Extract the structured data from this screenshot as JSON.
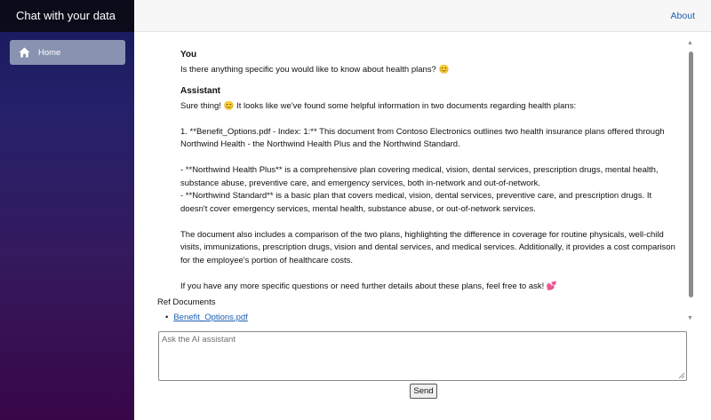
{
  "sidebar": {
    "title": "Chat with your data",
    "items": [
      {
        "label": "Home",
        "icon": "home-icon",
        "active": true
      }
    ]
  },
  "topbar": {
    "about_label": "About"
  },
  "chat": {
    "messages": [
      {
        "role": "You",
        "text": "Is there anything specific you would like to know about health plans? 😊"
      },
      {
        "role": "Assistant",
        "text": "Sure thing! 😊 It looks like we've found some helpful information in two documents regarding health plans:\n\n1. **Benefit_Options.pdf - Index: 1:** This document from Contoso Electronics outlines two health insurance plans offered through Northwind Health - the Northwind Health Plus and the Northwind Standard.\n\n- **Northwind Health Plus** is a comprehensive plan covering medical, vision, dental services, prescription drugs, mental health, substance abuse, preventive care, and emergency services, both in-network and out-of-network.\n- **Northwind Standard** is a basic plan that covers medical, vision, dental services, preventive care, and prescription drugs. It doesn't cover emergency services, mental health, substance abuse, or out-of-network services.\n\nThe document also includes a comparison of the two plans, highlighting the difference in coverage for routine physicals, well-child visits, immunizations, prescription drugs, vision and dental services, and medical services. Additionally, it provides a cost comparison for the employee's portion of healthcare costs.\n\nIf you have any more specific questions or need further details about these plans, feel free to ask! 💕"
      }
    ]
  },
  "refs": {
    "title": "Ref Documents",
    "documents": [
      "Benefit_Options.pdf"
    ]
  },
  "input": {
    "placeholder": "Ask the AI assistant",
    "value": ""
  },
  "send_label": "Send",
  "colors": {
    "accent_link": "#1e5fb3",
    "sidebar_header": "#0b0b1a",
    "nav_active": "#8893b2"
  }
}
